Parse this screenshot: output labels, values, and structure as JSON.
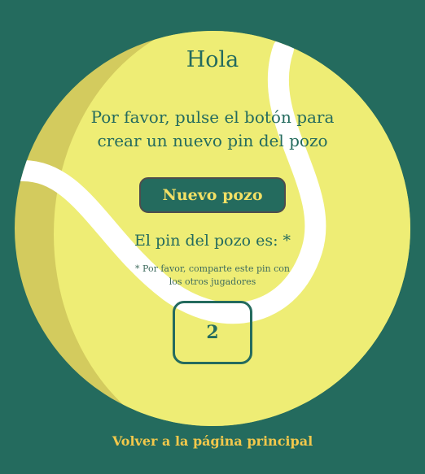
{
  "page": {
    "greeting": "Hola",
    "instructions": "Por favor, pulse el botón para crear un nuevo pin del pozo",
    "new_pool_button": "Nuevo pozo",
    "pin_label": "El pin del pozo es: *",
    "share_note": "* Por favor, comparte este pin con los otros jugadores",
    "pin_value": "2",
    "back_link": "Volver a la página principal"
  },
  "colors": {
    "background": "#246b5e",
    "ball": "#eeed75",
    "ball_shadow": "#d3cb5e",
    "seam": "#ffffff",
    "accent": "#f2c84b"
  },
  "icons": [
    "tennis-ball-illustration"
  ]
}
